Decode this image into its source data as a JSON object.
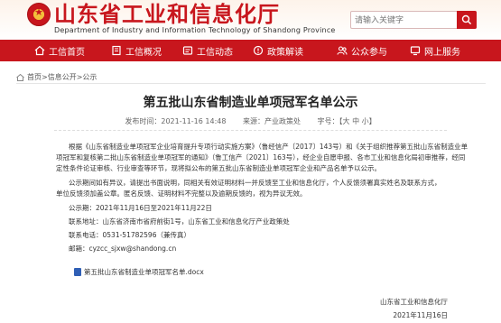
{
  "header": {
    "title_cn": "山东省工业和信息化厅",
    "title_en": "Department of Industry and Information Technology of Shandong Province",
    "search_placeholder": "请输入关键字"
  },
  "nav": [
    {
      "label": "工信首页",
      "icon": "home-icon"
    },
    {
      "label": "工信概况",
      "icon": "building-icon"
    },
    {
      "label": "工信动态",
      "icon": "news-icon"
    },
    {
      "label": "政策解读",
      "icon": "policy-icon"
    },
    {
      "label": "公众参与",
      "icon": "people-icon"
    },
    {
      "label": "网上服务",
      "icon": "service-icon"
    }
  ],
  "breadcrumb": "首页>信息公开>公示",
  "article": {
    "title": "第五批山东省制造业单项冠军名单公示",
    "publish_time": "发布时间：2021-11-16 14:48",
    "source": "来源：产业政策处",
    "font_size": "字号：【大 中 小】",
    "paragraph1_line1": "根据《山东省制造业单项冠军企业培育提升专项行动实施方案》（鲁经信产〔2017〕143号）和《关于组织推荐第五批山东省制造业单",
    "paragraph1_line2": "项冠军和复核第二批山东省制造业单项冠军的通知》（鲁工信产〔2021〕163号），经企业自愿申报、各市工业和信息化局初审推荐，经同",
    "paragraph1_line3": "定性条件论证审核、行业审查等环节，现将拟公布的第五批山东省制造业单项冠军企业和产品名单予以公示。",
    "paragraph2_line1": "公示期间如有异议，请提出书面说明，同相关有效证明材料一并反馈至工业和信息化厅，个人反馈须署真实姓名及联系方式，",
    "paragraph2_line2": "单位反馈须加盖公章。匿名反馈、证明材料不完整以及逾期反馈的，视为异议无效。",
    "period": "公示期：2021年11月16日至2021年11月22日",
    "address": "联系地址：山东省济南市省府前街1号，山东省工业和信息化厅产业政策处",
    "phone": "联系电话：0531-51782596（兼传真）",
    "email": "邮箱：cyzcc_sjxw@shandong.cn",
    "attachment": "第五批山东省制造业单项冠军名单.docx",
    "sign_org": "山东省工业和信息化厅",
    "sign_date": "2021年11月16日"
  },
  "colors": {
    "brand_red": "#c8161d"
  }
}
